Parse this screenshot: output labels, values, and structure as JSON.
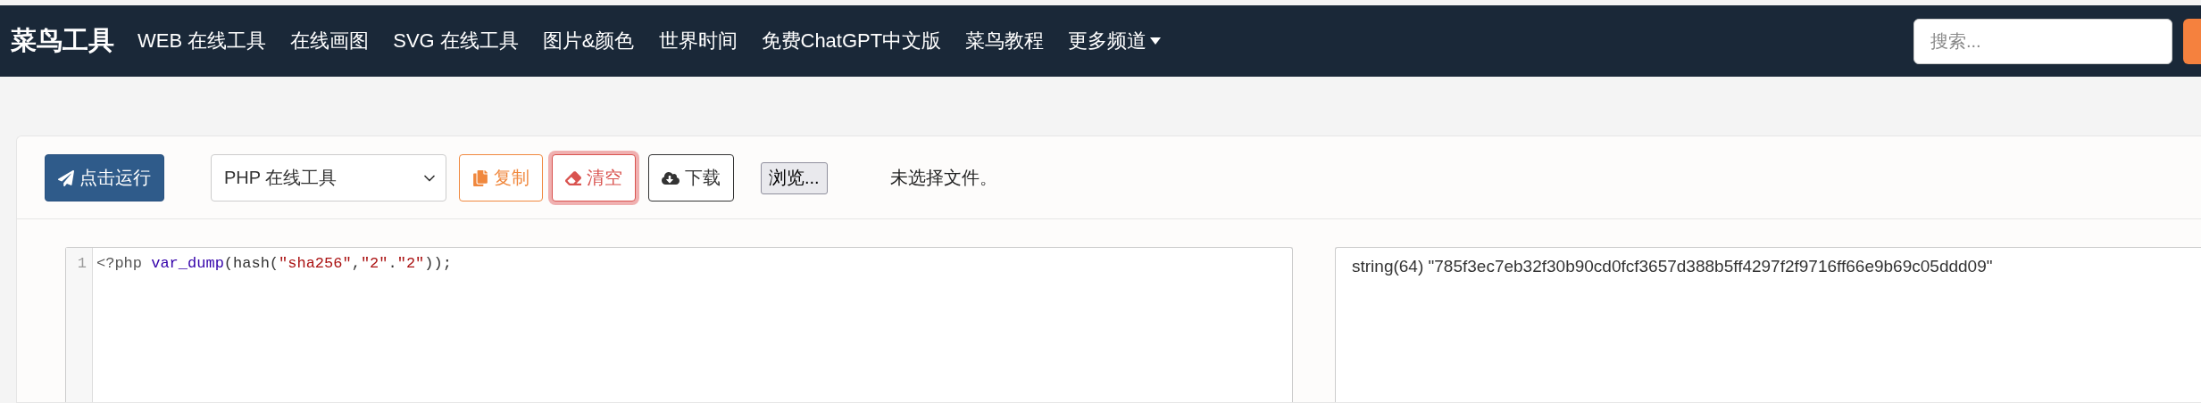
{
  "navbar": {
    "logo": "菜鸟工具",
    "links": [
      {
        "label": "WEB 在线工具"
      },
      {
        "label": "在线画图"
      },
      {
        "label": "SVG 在线工具"
      },
      {
        "label": "图片&颜色"
      },
      {
        "label": "世界时间"
      },
      {
        "label": "免费ChatGPT中文版"
      },
      {
        "label": "菜鸟教程"
      }
    ],
    "more": {
      "label": "更多频道"
    },
    "search": {
      "placeholder": "搜索..."
    }
  },
  "toolbar": {
    "run_button": "点击运行",
    "language_select": "PHP 在线工具",
    "copy_button": "复制",
    "clear_button": "清空",
    "download_button": "下载",
    "file_button": "浏览...",
    "file_status": "未选择文件。"
  },
  "editor": {
    "lines": [
      {
        "number": "1",
        "tokens": [
          {
            "kind": "meta",
            "text": "<?php "
          },
          {
            "kind": "builtin",
            "text": "var_dump"
          },
          {
            "kind": "plain",
            "text": "(hash("
          },
          {
            "kind": "string",
            "text": "\"sha256\""
          },
          {
            "kind": "plain",
            "text": ","
          },
          {
            "kind": "string",
            "text": "\"2\""
          },
          {
            "kind": "plain",
            "text": "."
          },
          {
            "kind": "string",
            "text": "\"2\""
          },
          {
            "kind": "plain",
            "text": "));"
          }
        ]
      }
    ]
  },
  "output": {
    "text": "string(64) \"785f3ec7eb32f30b90cd0fcf3657d388b5ff4297f2f9716ff66e9b69c05ddd09\""
  }
}
